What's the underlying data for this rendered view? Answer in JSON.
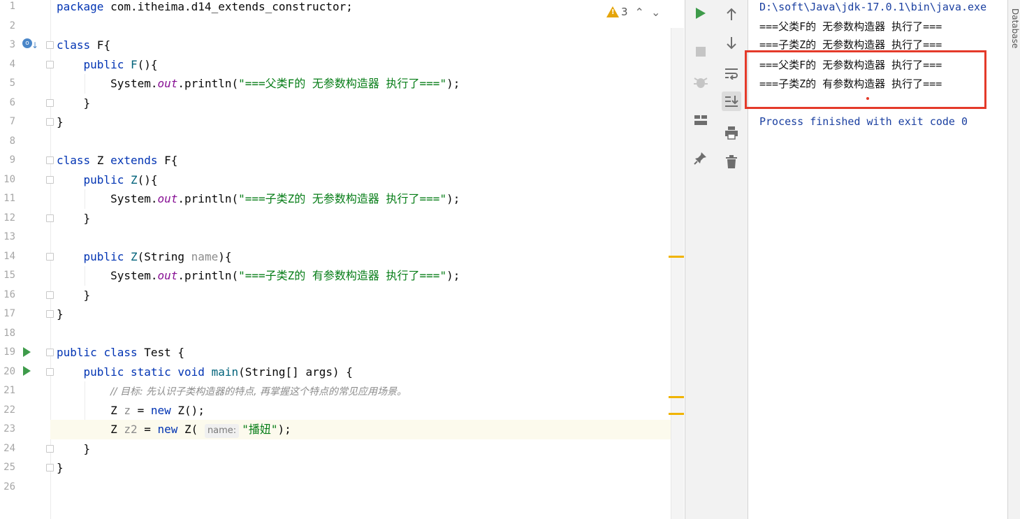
{
  "editor": {
    "line_numbers": [
      "1",
      "2",
      "3",
      "4",
      "5",
      "6",
      "7",
      "8",
      "9",
      "10",
      "11",
      "12",
      "13",
      "14",
      "15",
      "16",
      "17",
      "18",
      "19",
      "20",
      "21",
      "22",
      "23",
      "24",
      "25",
      "26"
    ],
    "warning_count": "3",
    "lines": {
      "l1_kw": "package",
      "l1_rest": " com.itheima.d14_extends_constructor;",
      "l3_kw": "class",
      "l3_rest": " F{",
      "l4_kw": "public",
      "l4_fn": "F",
      "l4_rest": "(){",
      "l5_a": "System.",
      "l5_fld": "out",
      "l5_b": ".println(",
      "l5_str": "\"===父类F的 无参数构造器 执行了===\"",
      "l5_c": ");",
      "l6": "}",
      "l7": "}",
      "l9_kw": "class",
      "l9_a": " Z ",
      "l9_kw2": "extends",
      "l9_b": " F{",
      "l10_kw": "public",
      "l10_fn": "Z",
      "l10_rest": "(){",
      "l11_a": "System.",
      "l11_fld": "out",
      "l11_b": ".println(",
      "l11_str": "\"===子类Z的 无参数构造器 执行了===\"",
      "l11_c": ");",
      "l12": "}",
      "l14_kw": "public",
      "l14_fn": "Z",
      "l14_a": "(String ",
      "l14_par": "name",
      "l14_b": "){",
      "l15_a": "System.",
      "l15_fld": "out",
      "l15_b": ".println(",
      "l15_str": "\"===子类Z的 有参数构造器 执行了===\"",
      "l15_c": ");",
      "l16": "}",
      "l17": "}",
      "l19_kw": "public",
      "l19_kw2": "class",
      "l19_rest": " Test {",
      "l20_kw": "public",
      "l20_kw2": "static",
      "l20_kw3": "void",
      "l20_fn": "main",
      "l20_rest": "(String[] args) {",
      "l21_cmt": "// 目标: 先认识子类构造器的特点, 再掌握这个特点的常见应用场景。",
      "l22_a": "Z ",
      "l22_par": "z",
      "l22_b": " = ",
      "l22_kw": "new",
      "l22_c": " Z();",
      "l23_a": "Z ",
      "l23_par": "z2",
      "l23_b": " = ",
      "l23_kw": "new",
      "l23_c": " Z( ",
      "l23_hint": "name:",
      "l23_str": "\"播妞\"",
      "l23_d": ");",
      "l24": "}",
      "l25": "}"
    }
  },
  "console": {
    "lines": [
      "D:\\soft\\Java\\jdk-17.0.1\\bin\\java.exe",
      "===父类F的 无参数构造器 执行了===",
      "===子类Z的 无参数构造器 执行了===",
      "===父类F的 无参数构造器 执行了===",
      "===子类Z的 有参数构造器 执行了==="
    ],
    "exit": "Process finished with exit code 0"
  },
  "sidebar": {
    "database_tab": "Database"
  },
  "colors": {
    "keyword": "#0033b3",
    "string": "#067d17",
    "field": "#871094",
    "highlight_box": "#e43a2a",
    "run_green": "#3e9b4a"
  },
  "icons": [
    "run-icon",
    "stop-icon",
    "debug-disabled-icon",
    "layout-icon",
    "pin-icon",
    "up-arrow-icon",
    "down-arrow-icon",
    "soft-wrap-icon",
    "scroll-to-end-icon",
    "print-icon",
    "trash-icon",
    "warning-icon",
    "chevron-up-icon",
    "chevron-down-icon"
  ]
}
